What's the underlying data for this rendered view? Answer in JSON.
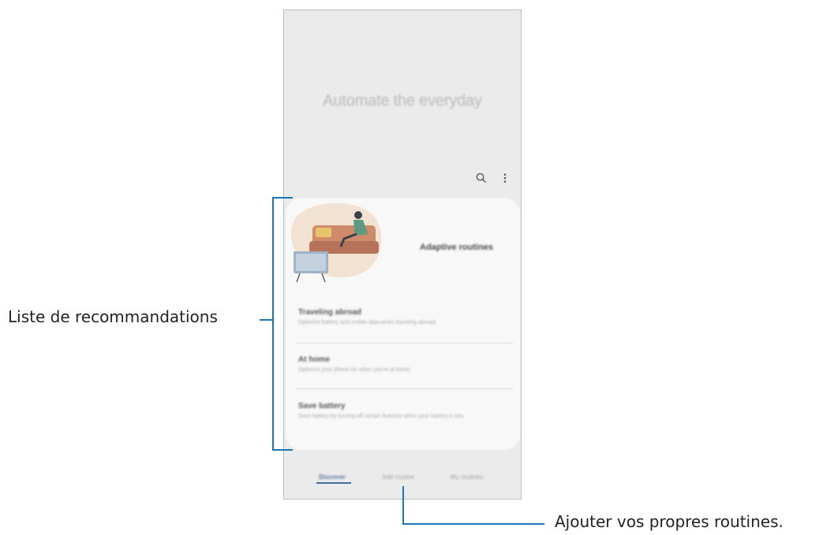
{
  "app": {
    "hero_title": "Automate the everyday"
  },
  "toolbar": {
    "search_icon": "search-icon",
    "more_icon": "more-vert-icon"
  },
  "card": {
    "header": "Adaptive routines",
    "items": [
      {
        "title": "Traveling abroad",
        "desc": "Optimize battery and mobile data when traveling abroad."
      },
      {
        "title": "At home",
        "desc": "Optimize your phone for when you're at home."
      },
      {
        "title": "Save battery",
        "desc": "Save battery by turning off certain features when your battery is low."
      }
    ]
  },
  "tabs": [
    {
      "label": "Discover",
      "active": true
    },
    {
      "label": "Add routine",
      "active": false
    },
    {
      "label": "My routines",
      "active": false
    }
  ],
  "annotations": {
    "recommendations": "Liste de recommandations",
    "add_routines": "Ajouter vos propres routines."
  },
  "colors": {
    "callout_line": "#1b75bb",
    "accent_tab": "#3f6da3"
  }
}
